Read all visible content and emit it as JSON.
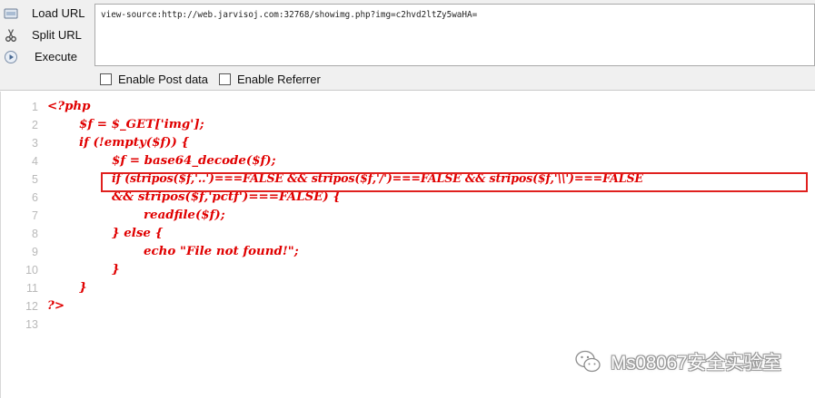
{
  "toolbar": {
    "load_url_label": "Load URL",
    "split_url_label": "Split URL",
    "execute_label": "Execute",
    "url_value": "view-source:http://web.jarvisoj.com:32768/showimg.php?img=c2hvd2ltZy5waHA=",
    "enable_post_label": "Enable Post data",
    "enable_referrer_label": "Enable Referrer"
  },
  "source": {
    "lines": [
      {
        "n": "1",
        "text": "<?php"
      },
      {
        "n": "2",
        "text": "$f = $_GET['img'];"
      },
      {
        "n": "3",
        "text": "if (!empty($f)) {"
      },
      {
        "n": "4",
        "text": "$f = base64_decode($f);"
      },
      {
        "n": "5",
        "text": "if (stripos($f,'..')===FALSE && stripos($f,'/')===FALSE && stripos($f,'\\\\')===FALSE"
      },
      {
        "n": "6",
        "text": "&& stripos($f,'pctf')===FALSE) {"
      },
      {
        "n": "7",
        "text": "readfile($f);"
      },
      {
        "n": "8",
        "text": "} else {"
      },
      {
        "n": "9",
        "text": "echo \"File not found!\";"
      },
      {
        "n": "10",
        "text": "}"
      },
      {
        "n": "11",
        "text": "}"
      },
      {
        "n": "12",
        "text": "?>"
      },
      {
        "n": "13",
        "text": ""
      }
    ]
  },
  "watermark": {
    "text": "Ms08067安全实验室",
    "icon": "wechat-icon"
  },
  "colors": {
    "code": "#e00000",
    "highlight_box": "#e0201e",
    "line_number": "#b9b9b9",
    "toolbar_bg": "#f0f0f0"
  }
}
